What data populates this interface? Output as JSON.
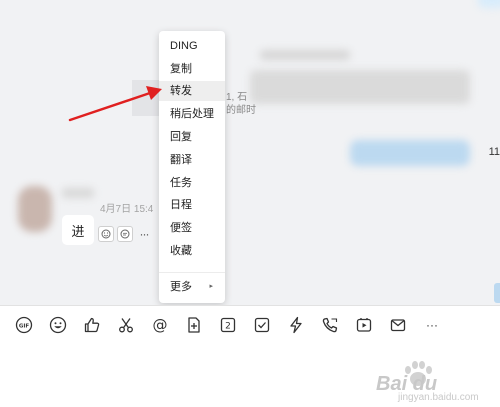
{
  "chat": {
    "right_number_peek": "11",
    "peek_line1": "1, 石",
    "peek_line2": "的邮时",
    "message": {
      "timestamp": "4月7日 15:4",
      "text": "进"
    }
  },
  "context_menu": {
    "items": [
      {
        "label": "DING"
      },
      {
        "label": "复制"
      },
      {
        "label": "转发"
      },
      {
        "label": "稍后处理"
      },
      {
        "label": "回复"
      },
      {
        "label": "翻译"
      },
      {
        "label": "任务"
      },
      {
        "label": "日程"
      },
      {
        "label": "便签"
      },
      {
        "label": "收藏"
      }
    ],
    "more_label": "更多",
    "more_arrow": "▸",
    "highlighted": "转发"
  },
  "toolbar": {
    "items": [
      {
        "name": "gif-icon",
        "glyph": "GIF"
      },
      {
        "name": "emoji-icon"
      },
      {
        "name": "thumbs-up-icon"
      },
      {
        "name": "scissors-icon"
      },
      {
        "name": "mention-icon",
        "glyph": "@"
      },
      {
        "name": "add-file-icon"
      },
      {
        "name": "ding-icon",
        "glyph": "2"
      },
      {
        "name": "checkbox-icon"
      },
      {
        "name": "lightning-icon"
      },
      {
        "name": "phone-icon"
      },
      {
        "name": "video-icon"
      },
      {
        "name": "mail-icon"
      },
      {
        "name": "more-icon",
        "glyph": "···"
      }
    ]
  },
  "annotation": {
    "arrow_color": "#e02020"
  },
  "watermark": {
    "logo": "Bai du",
    "sub": "jingyan.baidu.com"
  }
}
